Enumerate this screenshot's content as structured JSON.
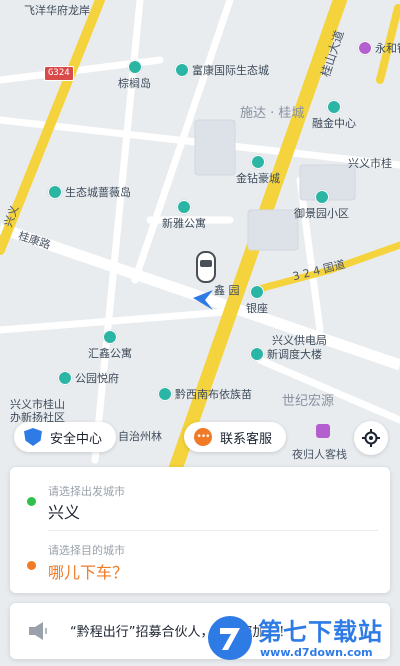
{
  "map": {
    "roads": {
      "guikang": "桂康路",
      "guishan": "桂山大道",
      "national_highway": "3 2 4 国道",
      "shield": "G324",
      "left_vertical": "兴义"
    },
    "places": [
      {
        "key": "feiyang",
        "name": "飞洋华府龙岸"
      },
      {
        "key": "zongliao",
        "name": "棕榈岛"
      },
      {
        "key": "fukang",
        "name": "富康国际生态城"
      },
      {
        "key": "shida",
        "name": "施达 · 桂城"
      },
      {
        "key": "yongheyin",
        "name": "永和银"
      },
      {
        "key": "rongjin",
        "name": "融金中心"
      },
      {
        "key": "xingyishi",
        "name": "兴义市桂"
      },
      {
        "key": "jinzuan",
        "name": "金钻豪城"
      },
      {
        "key": "shengtai",
        "name": "生态城蔷薇岛"
      },
      {
        "key": "yujing",
        "name": "御景园小区"
      },
      {
        "key": "xinya",
        "name": "新雅公寓"
      },
      {
        "key": "xin_yuan",
        "name": "鑫 园"
      },
      {
        "key": "yinzuo",
        "name": "银座"
      },
      {
        "key": "gongdian",
        "name": "兴义供电局"
      },
      {
        "key": "xintiao",
        "name": "新调度大楼"
      },
      {
        "key": "huixin",
        "name": "汇鑫公寓"
      },
      {
        "key": "gongyuan",
        "name": "公园悦府"
      },
      {
        "key": "shiji",
        "name": "世纪宏源"
      },
      {
        "key": "xingyi_gui",
        "name": "兴义市桂山"
      },
      {
        "key": "banshi",
        "name": "办新扬社区"
      },
      {
        "key": "qianxinan",
        "name": "黔西南布依族苗"
      },
      {
        "key": "zizhi",
        "name": "自治州林"
      },
      {
        "key": "yeguiren",
        "name": "夜归人客栈"
      }
    ]
  },
  "quick_actions": {
    "safety": "安全中心",
    "service": "联系客服"
  },
  "booking": {
    "origin_hint": "请选择出发城市",
    "origin_value": "兴义",
    "dest_hint": "请选择目的城市",
    "dest_value": "哪儿下车？"
  },
  "notice": {
    "text": "“黔程出行”招募合伙人，诚邀您加入！"
  },
  "watermark": {
    "title": "第七下载站",
    "url": "www.d7down.com"
  },
  "colors": {
    "accent_blue": "#2f7be6",
    "accent_orange": "#f07a25",
    "origin_green": "#2fbf4a",
    "main_road": "#f5d33c",
    "poi_teal": "#2bb5a5"
  }
}
